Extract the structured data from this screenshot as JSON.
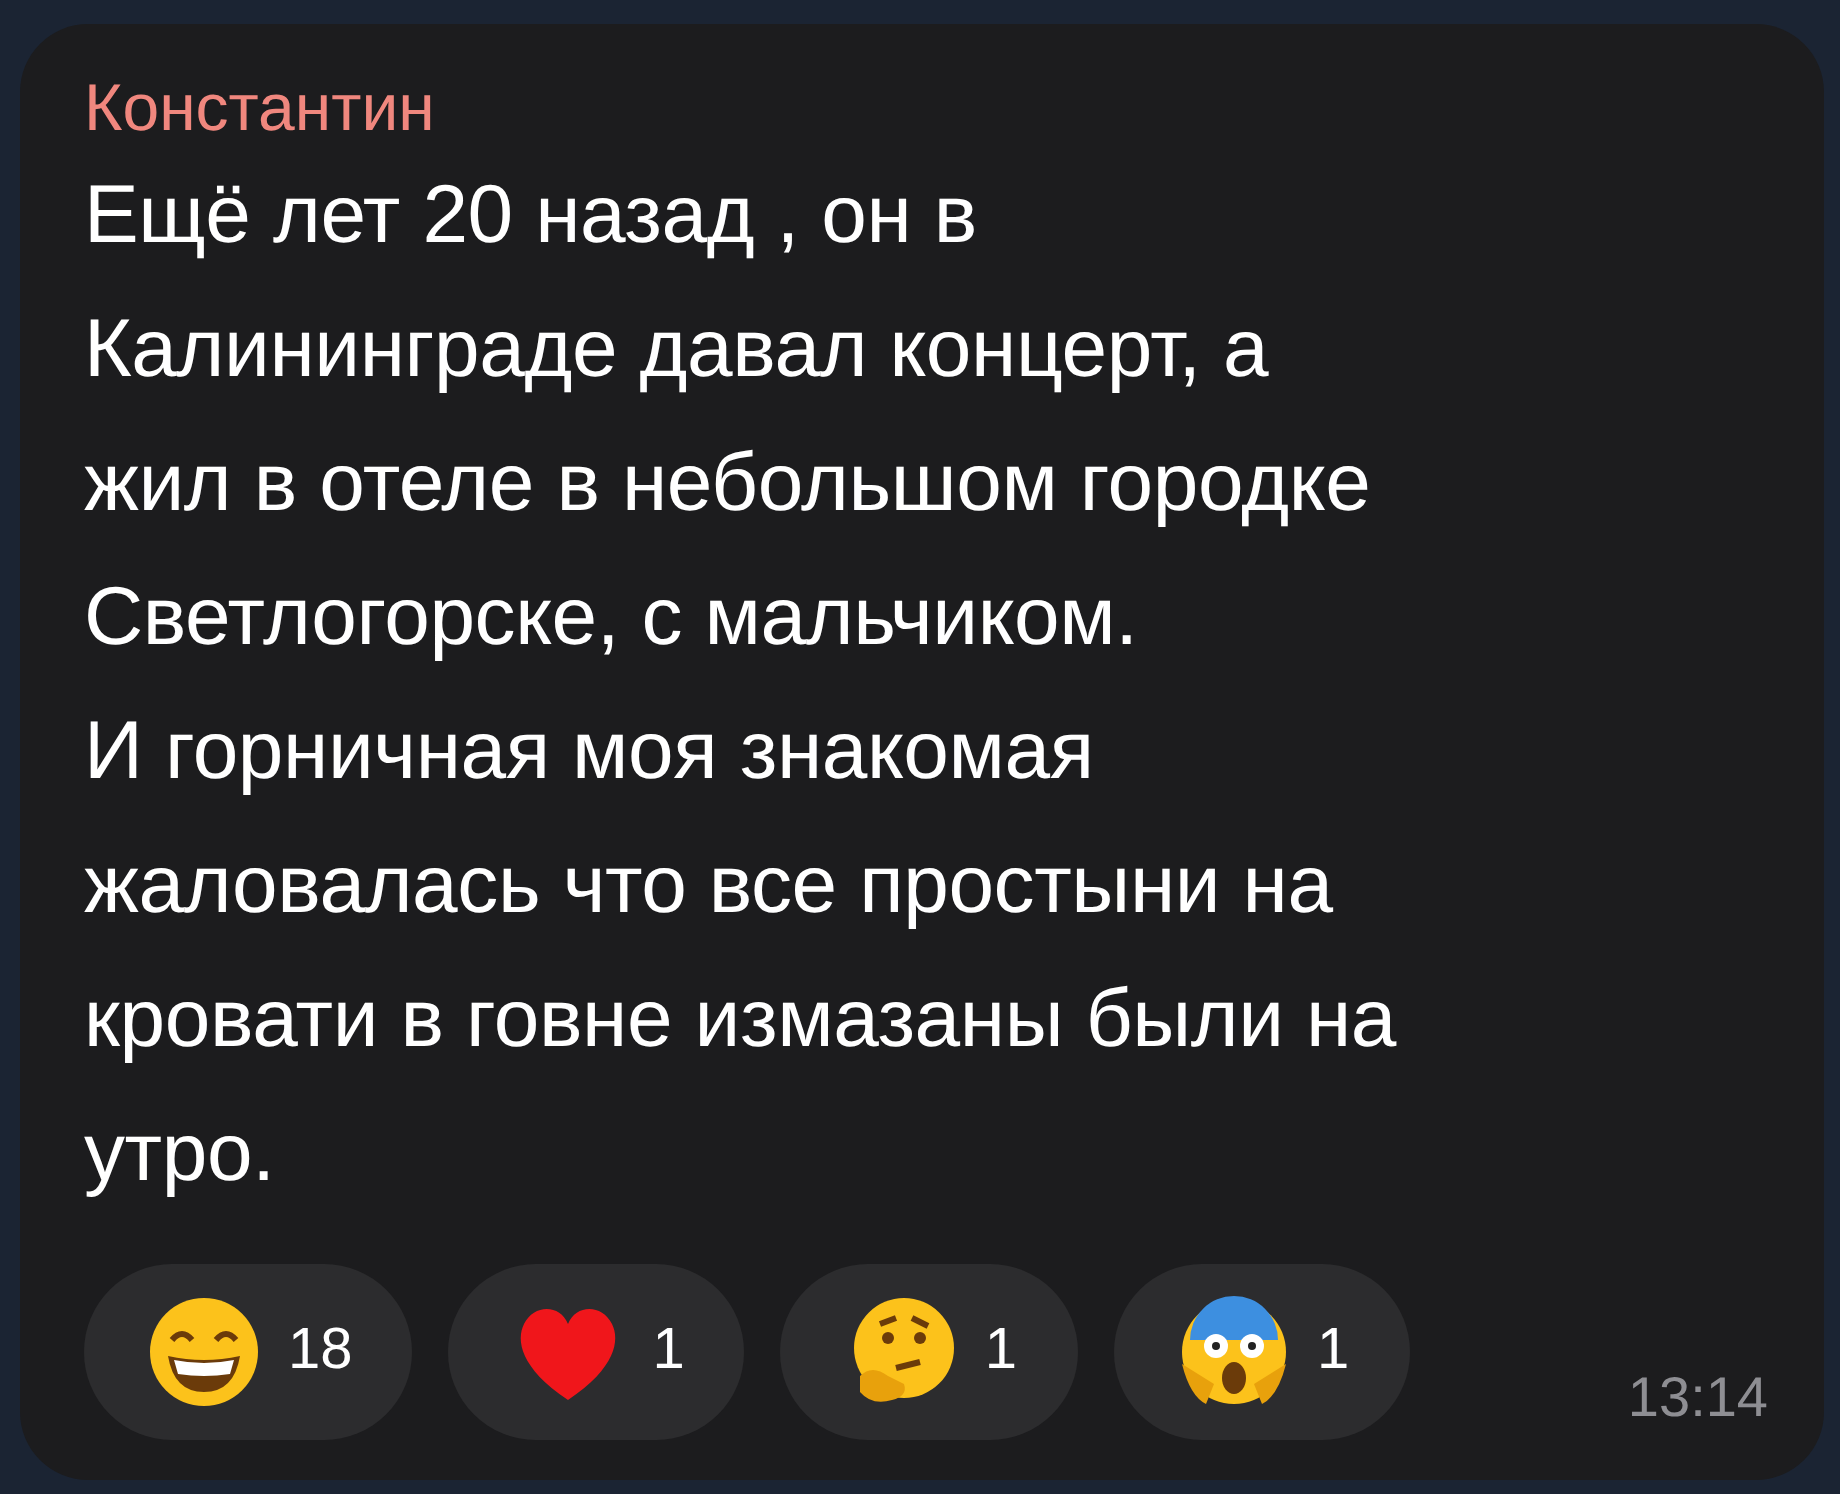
{
  "message": {
    "sender": "Константин",
    "lines": [
      "Ещё лет 20 назад , он в",
      "Калининграде давал концерт, а",
      "жил в отеле в небольшом городке",
      "Светлогорске, с мальчиком.",
      "И горничная моя знакомая",
      "жаловалась что все простыни на",
      "кровати в говне измазаны были на",
      "утро."
    ],
    "reactions": [
      {
        "kind": "grin",
        "count": "18"
      },
      {
        "kind": "heart",
        "count": "1"
      },
      {
        "kind": "thinking",
        "count": "1"
      },
      {
        "kind": "scream",
        "count": "1"
      }
    ],
    "time": "13:14"
  }
}
